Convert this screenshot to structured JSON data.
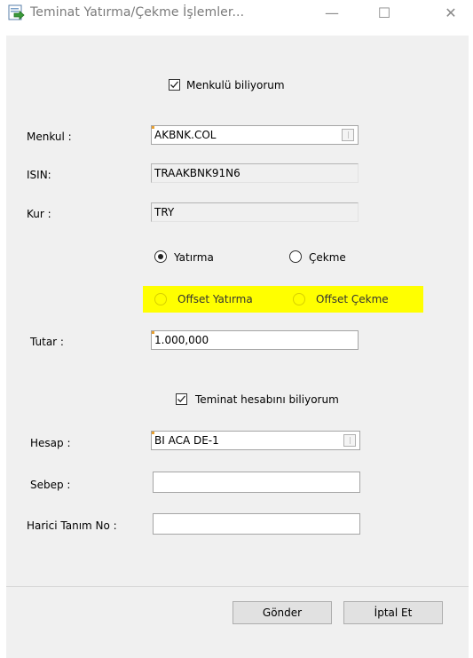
{
  "window": {
    "title": "Teminat Yatırma/Çekme İşlemler...",
    "icon": "form-arrow-icon",
    "minimize_glyph": "—",
    "maximize_glyph": "☐",
    "close_glyph": "✕"
  },
  "form": {
    "menkul_known": {
      "label": "Menkulü biliyorum",
      "checked": true
    },
    "menkul": {
      "label": "Menkul :",
      "value": "AKBNK.COL"
    },
    "isin": {
      "label": "ISIN:",
      "value": "TRAAKBNK91N6"
    },
    "kur": {
      "label": "Kur :",
      "value": "TRY"
    },
    "operation": {
      "options": [
        {
          "label": "Yatırma",
          "selected": true
        },
        {
          "label": "Çekme",
          "selected": false
        }
      ]
    },
    "offset": {
      "highlight_color": "#ffff00",
      "options": [
        {
          "label": "Offset Yatırma",
          "selected": false
        },
        {
          "label": "Offset Çekme",
          "selected": false
        }
      ]
    },
    "tutar": {
      "label": "Tutar :",
      "value": "1.000,000"
    },
    "account_known": {
      "label": "Teminat hesabını biliyorum",
      "checked": true
    },
    "hesap": {
      "label": "Hesap :",
      "value": "BI ACA DE-1"
    },
    "sebep": {
      "label": "Sebep :",
      "value": ""
    },
    "harici": {
      "label": "Harici Tanım No :",
      "value": ""
    }
  },
  "buttons": {
    "send": "Gönder",
    "cancel": "İptal Et"
  },
  "colors": {
    "window_bg": "#f0f0f0",
    "highlight": "#ffff00",
    "field_marker": "#e8a030"
  }
}
